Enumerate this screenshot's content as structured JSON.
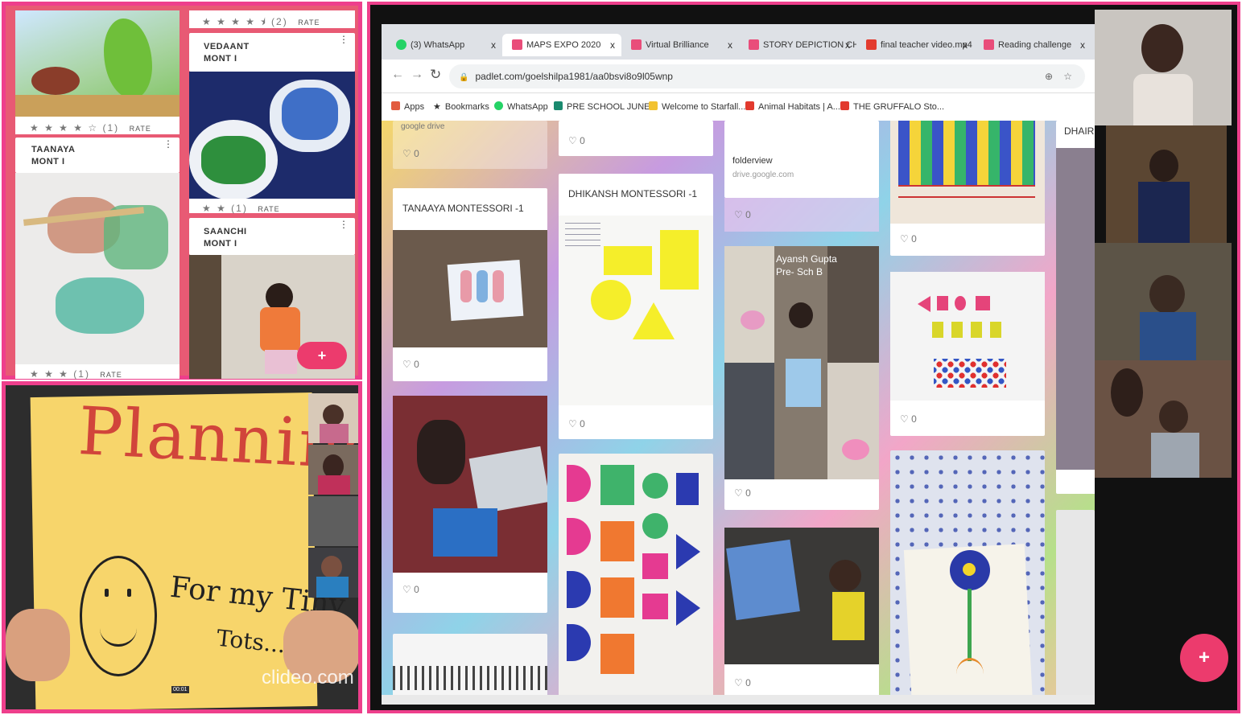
{
  "padlet_mobile": {
    "cards": [
      {
        "name": "",
        "rating": "★ ★ ★ ★ ☆ (1)",
        "rate_label": "RATE"
      },
      {
        "name": "TAANAYA\nMONT I",
        "rating": "★ ★ ★ (1)",
        "rate_label": "RATE"
      },
      {
        "name": "VEDAANT\nMONT I",
        "rating_top": "★ ★ ★ ★ ½ (2)",
        "rating": "★ ★ (1)",
        "rate_label": "RATE"
      },
      {
        "name": "SAANCHI\nMONT I"
      }
    ],
    "top_rating": "★ ★ ★ ★ ⯨ (2)",
    "top_rate": "RATE",
    "fab": "+"
  },
  "video": {
    "sign_word": "Planning",
    "sign_line2": "For my Tiny",
    "sign_line3": "Tots...",
    "watermark": "clideo.com",
    "timestamp": "00:01"
  },
  "browser": {
    "tabs": [
      {
        "label": "(3) WhatsApp",
        "color": "#25d366"
      },
      {
        "label": "MAPS EXPO 2020",
        "color": "#e94d7a"
      },
      {
        "label": "Virtual Brilliance",
        "color": "#e94d7a"
      },
      {
        "label": "STORY DEPICTION CH...",
        "color": "#e94d7a"
      },
      {
        "label": "final teacher video.mp4",
        "color": "#e33b2e"
      },
      {
        "label": "Reading challenge",
        "color": "#e94d7a"
      }
    ],
    "url": "padlet.com/goelshilpa1981/aa0bsvi8o9l05wnp",
    "bookmarks": [
      {
        "label": "Apps",
        "color": "#e25b3f"
      },
      {
        "label": "Bookmarks",
        "color": "#444"
      },
      {
        "label": "WhatsApp",
        "color": "#25d366"
      },
      {
        "label": "PRE SCHOOL JUNE...",
        "color": "#1a8a6f"
      },
      {
        "label": "Welcome to Starfall...",
        "color": "#f2c230"
      },
      {
        "label": "Animal Habitats | A...",
        "color": "#e23a2e"
      },
      {
        "label": "THE GRUFFALO Sto...",
        "color": "#e23a2e"
      }
    ]
  },
  "padlet": {
    "google_drive": "google drive",
    "col1_title": "TANAAYA MONTESSORI -1",
    "col2_title": "DHIKANSH MONTESSORI -1",
    "folderview_title": "folderview",
    "folderview_url": "drive.google.com",
    "ayansh_caption": "Ayansh Gupta\nPre- Sch B",
    "dhairya": "DHAIR",
    "like_count": "0",
    "sheet_labels": [
      "Circle",
      "Rectangle",
      "Square",
      "Triangle"
    ],
    "fab": "+"
  },
  "colors": {
    "frame_pink": "#ee3f8c",
    "fab_pink": "#ec3b6d",
    "sign_yellow": "#f7d56b"
  }
}
